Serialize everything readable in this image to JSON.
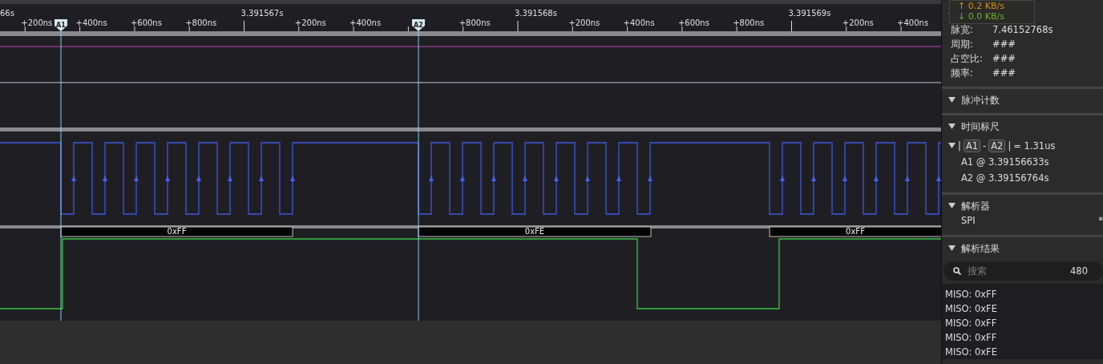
{
  "ruler": {
    "ticks": [
      {
        "kind": "major",
        "label": "66s"
      },
      {
        "kind": "minor",
        "label": "+200ns"
      },
      {
        "kind": "minor",
        "label": "+400ns"
      },
      {
        "kind": "minor",
        "label": "+600ns"
      },
      {
        "kind": "minor",
        "label": "+800ns"
      },
      {
        "kind": "major",
        "label": "3.391567s"
      },
      {
        "kind": "minor",
        "label": "+200ns"
      },
      {
        "kind": "minor",
        "label": "+400ns"
      },
      {
        "kind": "minor"
      },
      {
        "kind": "minor",
        "label": "+800ns"
      },
      {
        "kind": "major",
        "label": "3.391568s"
      },
      {
        "kind": "minor",
        "label": "+200ns"
      },
      {
        "kind": "minor",
        "label": "+400ns"
      },
      {
        "kind": "minor",
        "label": "+600ns"
      },
      {
        "kind": "minor",
        "label": "+800ns"
      },
      {
        "kind": "major",
        "label": "3.391569s"
      },
      {
        "kind": "minor",
        "label": "+200ns"
      },
      {
        "kind": "minor",
        "label": "+400ns"
      }
    ]
  },
  "cursors": [
    {
      "label": "A1"
    },
    {
      "label": "A2"
    }
  ],
  "decode": [
    {
      "label": "0xFF"
    },
    {
      "label": "0xFE"
    },
    {
      "label": "0xFF"
    }
  ],
  "rate_tooltip": {
    "upload": "↑ 0.2 KB/s",
    "download": "↓ 0.0 KB/s"
  },
  "panel": {
    "sections": [
      {
        "kind": "measure",
        "expanded": true,
        "rows": [
          {
            "name": "脉宽:",
            "value": "7.46152768s"
          },
          {
            "name": "周期:",
            "value": "###"
          },
          {
            "name": "占空比:",
            "value": "###"
          },
          {
            "name": "频率:",
            "value": "###"
          }
        ]
      },
      {
        "kind": "plain",
        "expanded": true,
        "title": "脉冲计数"
      },
      {
        "kind": "ruler",
        "expanded": true,
        "title": "时间标尺",
        "delta": {
          "expanded": true,
          "parts": [
            {
              "kind": "text",
              "text": "|"
            },
            {
              "kind": "tag",
              "text": "A1"
            },
            {
              "kind": "text",
              "text": "-"
            },
            {
              "kind": "tag",
              "text": "A2"
            },
            {
              "kind": "text",
              "text": "|"
            },
            {
              "kind": "text",
              "text": "= 1.31us"
            }
          ]
        },
        "lines": [
          "A1 @ 3.39156633s",
          "A2 @ 3.39156764s"
        ]
      },
      {
        "kind": "decoders",
        "expanded": true,
        "title": "解析器",
        "items": [
          {
            "name": "SPI",
            "tail": "*"
          }
        ]
      },
      {
        "kind": "results",
        "expanded": true,
        "title": "解析结果",
        "search": {
          "placeholder": "搜索",
          "count": "480"
        },
        "items": [
          "MISO: 0xFF",
          "MISO: 0xFE",
          "MISO: 0xFF",
          "MISO: 0xFF",
          "MISO: 0xFE"
        ]
      }
    ]
  }
}
